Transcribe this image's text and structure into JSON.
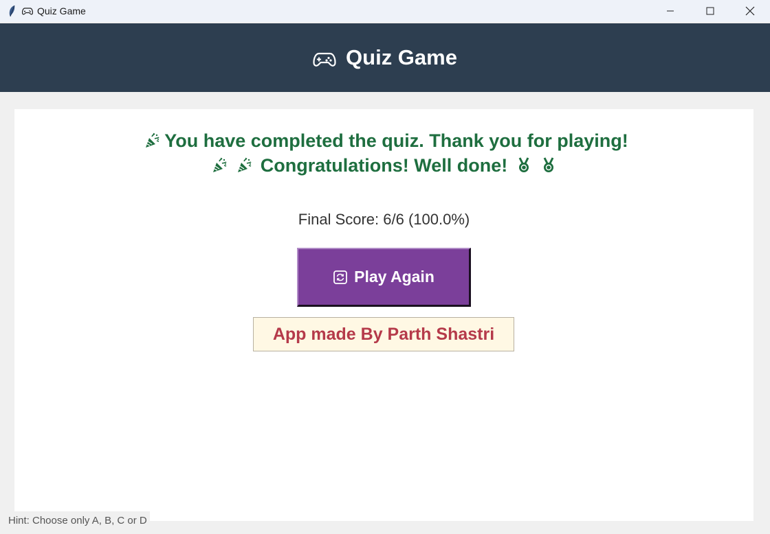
{
  "window": {
    "title": "Quiz Game",
    "app_icon": "feather-icon",
    "title_icon": "gamepad-icon",
    "controls": [
      "minimize-icon",
      "maximize-icon",
      "close-icon"
    ]
  },
  "header": {
    "icon": "gamepad-icon",
    "title": "Quiz Game",
    "background": "#2d3e50"
  },
  "result": {
    "line1_icon": "party-popper-icon",
    "line1": "You have completed the quiz. Thank you for playing!",
    "line2_icons_before": [
      "party-popper-icon",
      "party-popper-icon"
    ],
    "line2": "Congratulations! Well done!",
    "line2_icons_after": [
      "medal-icon",
      "medal-icon"
    ],
    "color": "#1e6e3f"
  },
  "score": {
    "text": "Final Score: 6/6 (100.0%)",
    "correct": 6,
    "total": 6,
    "percent": 100.0
  },
  "play_again": {
    "icon": "repeat-icon",
    "label": "Play Again",
    "color": "#7b3f9a"
  },
  "credit": {
    "text": "App made By Parth Shastri",
    "color": "#b53a4a",
    "background": "#fff8e4"
  },
  "hint": {
    "text": "Hint: Choose only A, B, C or D"
  }
}
